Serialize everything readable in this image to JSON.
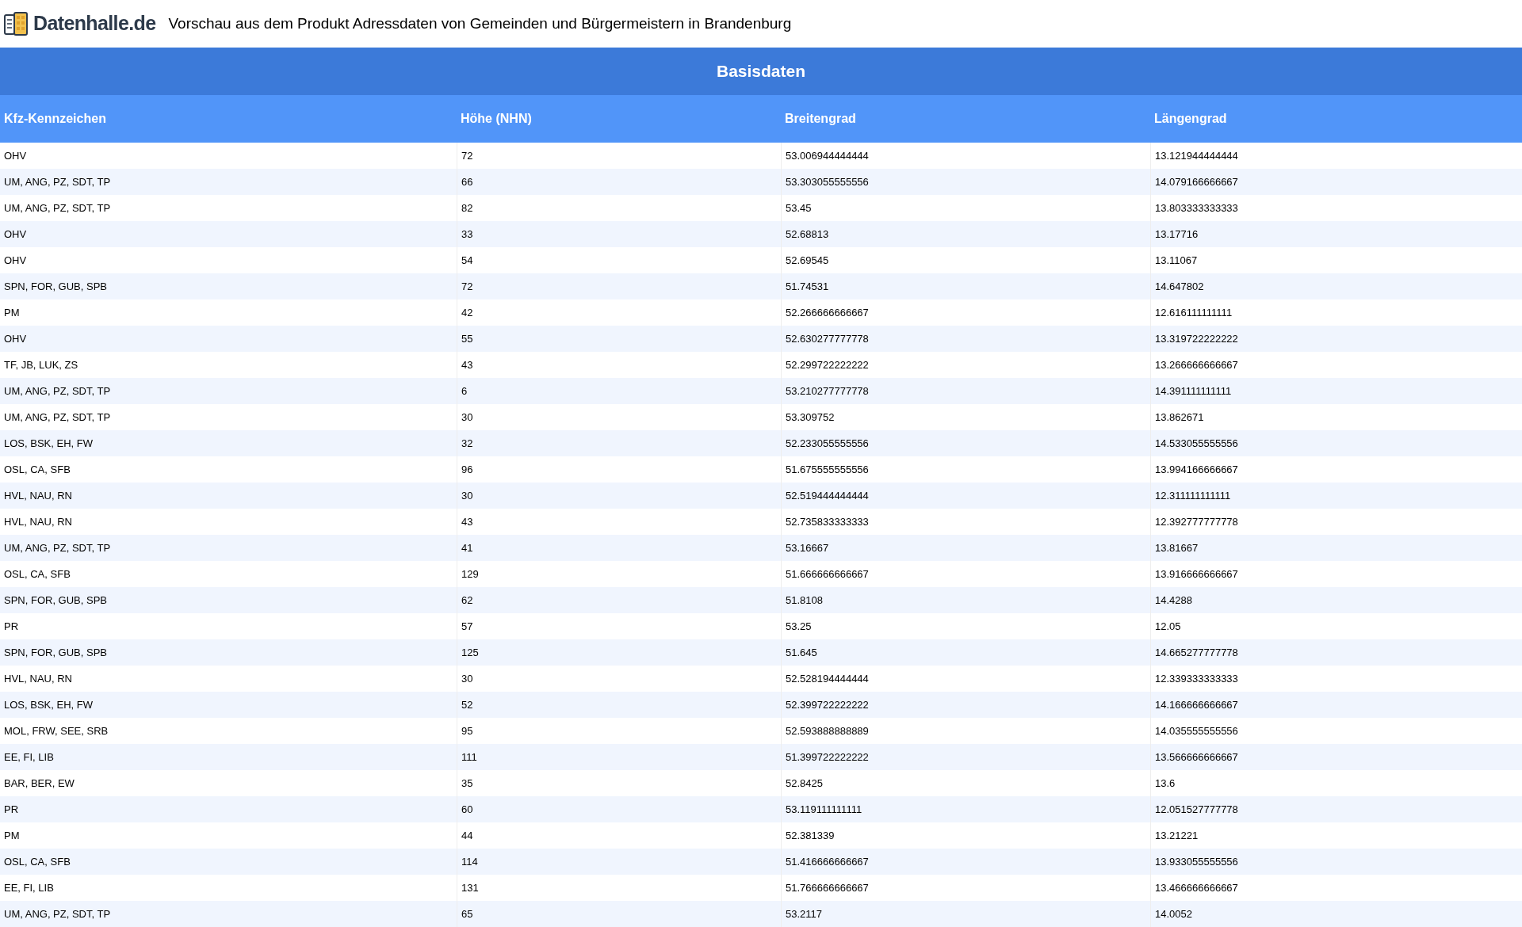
{
  "header": {
    "logo": "Datenhalle.de",
    "title": "Vorschau aus dem Produkt Adressdaten von Gemeinden und Bürgermeistern in Brandenburg"
  },
  "table": {
    "caption": "Basisdaten",
    "columns": [
      "Kfz-Kennzeichen",
      "Höhe (NHN)",
      "Breitengrad",
      "Längengrad"
    ],
    "rows": [
      [
        "OHV",
        "72",
        "53.006944444444",
        "13.121944444444"
      ],
      [
        "UM, ANG, PZ, SDT, TP",
        "66",
        "53.303055555556",
        "14.079166666667"
      ],
      [
        "UM, ANG, PZ, SDT, TP",
        "82",
        "53.45",
        "13.803333333333"
      ],
      [
        "OHV",
        "33",
        "52.68813",
        "13.17716"
      ],
      [
        "OHV",
        "54",
        "52.69545",
        "13.11067"
      ],
      [
        "SPN, FOR, GUB, SPB",
        "72",
        "51.74531",
        "14.647802"
      ],
      [
        "PM",
        "42",
        "52.266666666667",
        "12.616111111111"
      ],
      [
        "OHV",
        "55",
        "52.630277777778",
        "13.319722222222"
      ],
      [
        "TF, JB, LUK, ZS",
        "43",
        "52.299722222222",
        "13.266666666667"
      ],
      [
        "UM, ANG, PZ, SDT, TP",
        "6",
        "53.210277777778",
        "14.391111111111"
      ],
      [
        "UM, ANG, PZ, SDT, TP",
        "30",
        "53.309752",
        "13.862671"
      ],
      [
        "LOS, BSK, EH, FW",
        "32",
        "52.233055555556",
        "14.533055555556"
      ],
      [
        "OSL, CA, SFB",
        "96",
        "51.675555555556",
        "13.994166666667"
      ],
      [
        "HVL, NAU, RN",
        "30",
        "52.519444444444",
        "12.311111111111"
      ],
      [
        "HVL, NAU, RN",
        "43",
        "52.735833333333",
        "12.392777777778"
      ],
      [
        "UM, ANG, PZ, SDT, TP",
        "41",
        "53.16667",
        "13.81667"
      ],
      [
        "OSL, CA, SFB",
        "129",
        "51.666666666667",
        "13.916666666667"
      ],
      [
        "SPN, FOR, GUB, SPB",
        "62",
        "51.8108",
        "14.4288"
      ],
      [
        "PR",
        "57",
        "53.25",
        "12.05"
      ],
      [
        "SPN, FOR, GUB, SPB",
        "125",
        "51.645",
        "14.665277777778"
      ],
      [
        "HVL, NAU, RN",
        "30",
        "52.528194444444",
        "12.339333333333"
      ],
      [
        "LOS, BSK, EH, FW",
        "52",
        "52.399722222222",
        "14.166666666667"
      ],
      [
        "MOL, FRW, SEE, SRB",
        "95",
        "52.593888888889",
        "14.035555555556"
      ],
      [
        "EE, FI, LIB",
        "111",
        "51.399722222222",
        "13.566666666667"
      ],
      [
        "BAR, BER, EW",
        "35",
        "52.8425",
        "13.6"
      ],
      [
        "PR",
        "60",
        "53.119111111111",
        "12.051527777778"
      ],
      [
        "PM",
        "44",
        "52.381339",
        "13.21221"
      ],
      [
        "OSL, CA, SFB",
        "114",
        "51.416666666667",
        "13.933055555556"
      ],
      [
        "EE, FI, LIB",
        "131",
        "51.766666666667",
        "13.466666666667"
      ],
      [
        "UM, ANG, PZ, SDT, TP",
        "65",
        "53.2117",
        "14.0052"
      ]
    ]
  }
}
